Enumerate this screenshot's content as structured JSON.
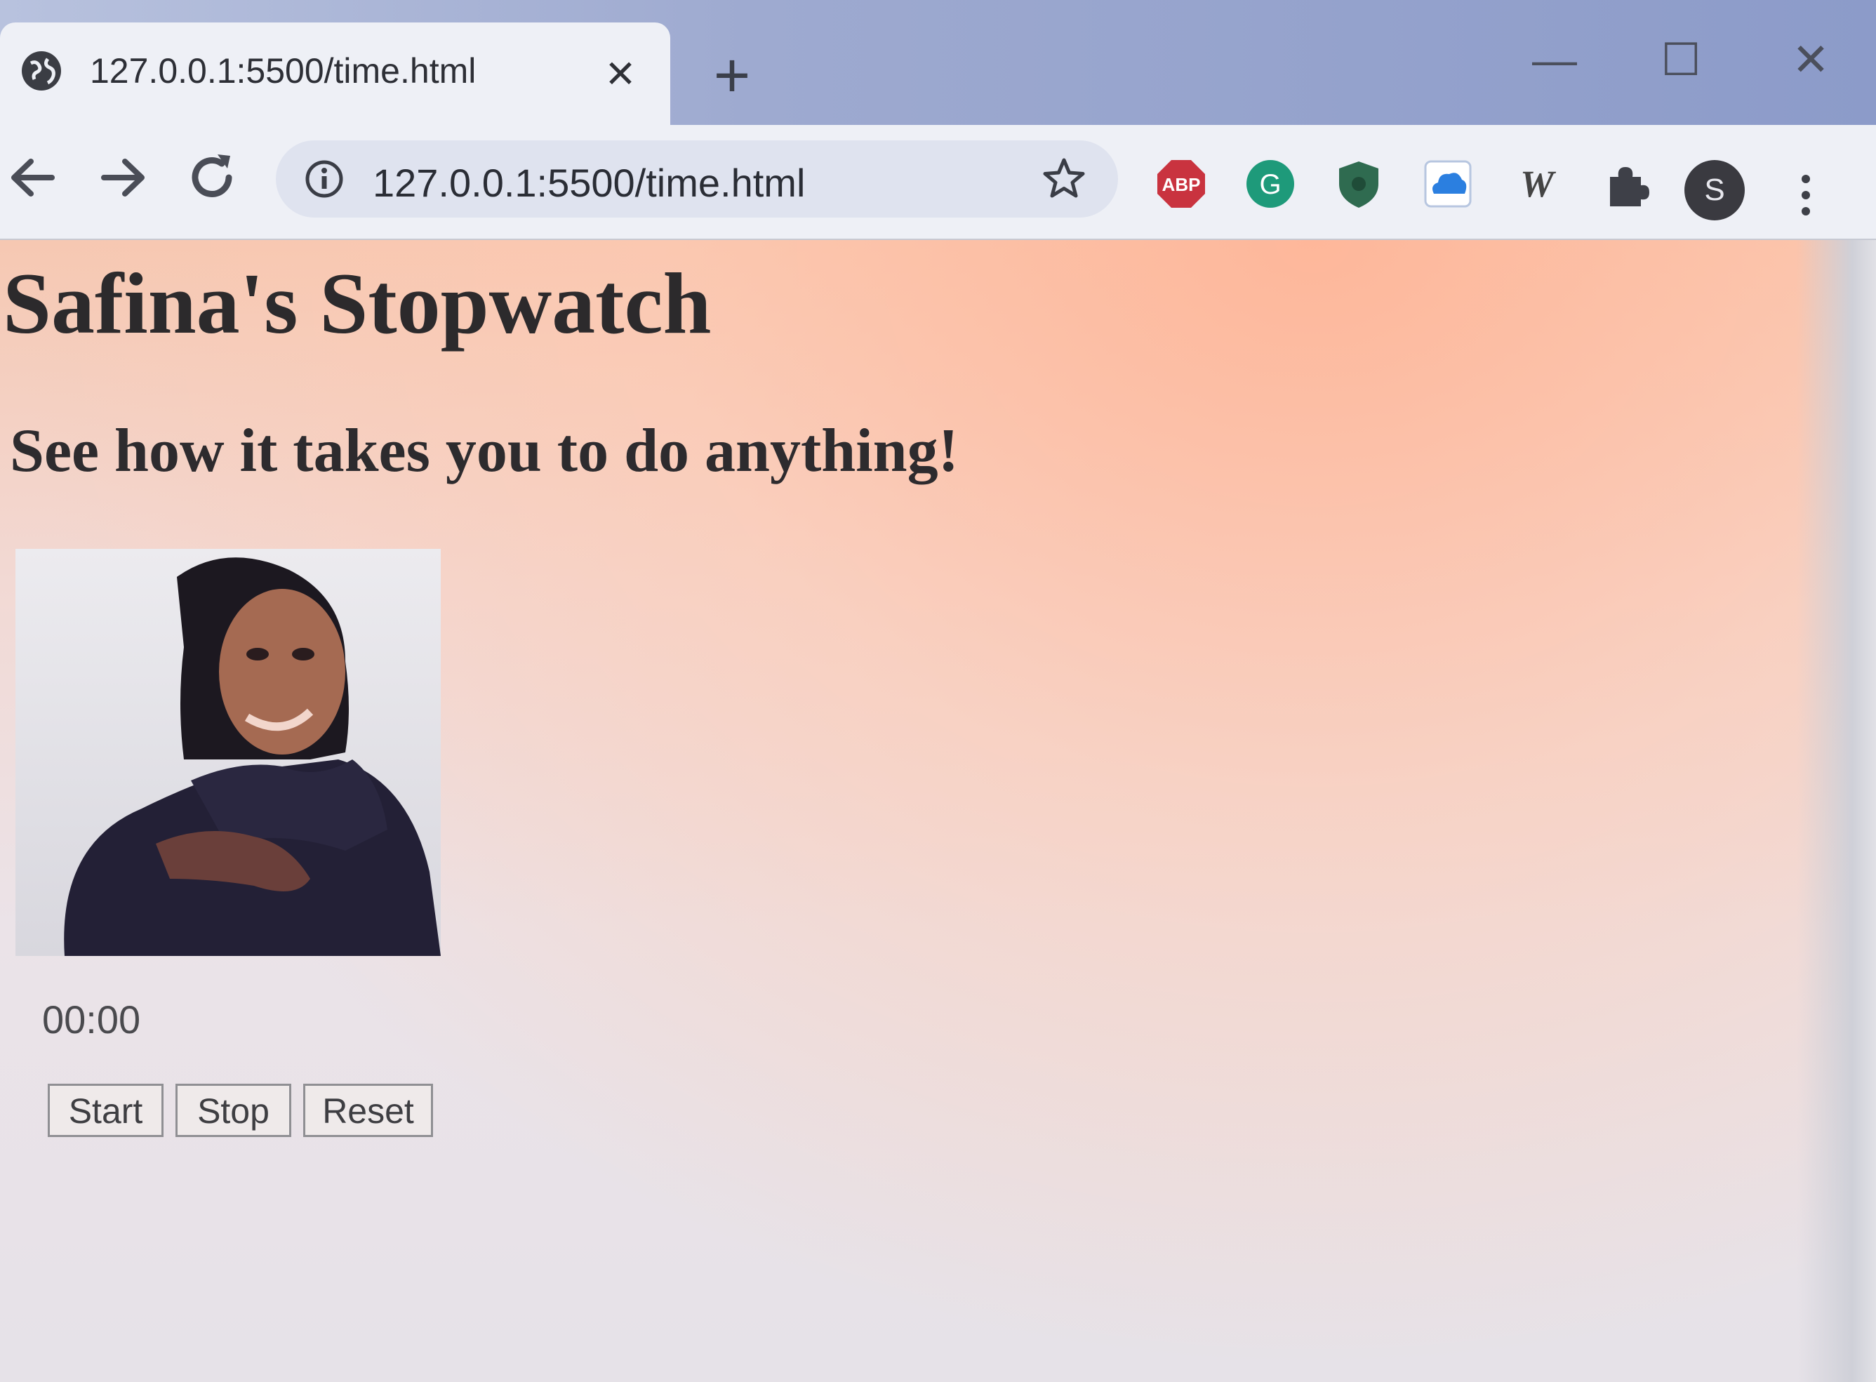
{
  "browser": {
    "tab_title": "127.0.0.1:5500/time.html",
    "tab_close": "✕",
    "new_tab": "+",
    "window_minimize": "—",
    "window_maximize": "☐",
    "window_close": "✕",
    "url": "127.0.0.1:5500/time.html",
    "extensions": [
      {
        "icon": "adblock-icon",
        "label": "ABP",
        "color": "#c9333f"
      },
      {
        "icon": "grammarly-icon",
        "label": "G",
        "color": "#1e9a7a"
      },
      {
        "icon": "shield-extension-icon",
        "label": "",
        "color": "#2f6b50"
      },
      {
        "icon": "cloud-extension-icon",
        "label": "",
        "color": "#2b7fe0"
      },
      {
        "icon": "w-extension-icon",
        "label": "W",
        "color": "#444"
      },
      {
        "icon": "puzzle-icon",
        "label": "",
        "color": "#444"
      }
    ],
    "profile_initial": "S"
  },
  "page": {
    "title": "Safina's Stopwatch",
    "subtitle": "See how it takes you to do anything!",
    "timer": "00:00",
    "buttons": {
      "start": "Start",
      "stop": "Stop",
      "reset": "Reset"
    }
  }
}
